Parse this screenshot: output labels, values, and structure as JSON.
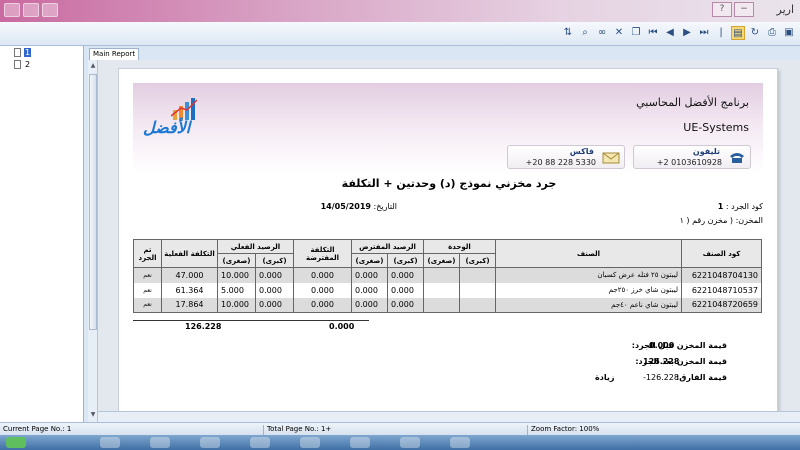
{
  "window": {
    "title": "ارير"
  },
  "tree": {
    "items": [
      "1",
      "2"
    ]
  },
  "tab": {
    "label": "Main Report"
  },
  "report": {
    "company_ar": "برنامج الأفضل المحاسبي",
    "company_en": "UE-Systems",
    "logo_text": "الأفضل",
    "fax_label": "فاكس",
    "fax_value": "+20 88 228 5330",
    "phone_label": "تليفون",
    "phone_value": "+2 0103610928",
    "title": "جرد مخزني نموذج (د) وحدتين + التكلفة",
    "inventory_code_label": "كود الجرد :",
    "inventory_code": "1",
    "date_label": "التاريخ:",
    "date": "14/05/2019",
    "store_label": "المخزن: ( مخزن رقم ( ١",
    "headers": {
      "item_code": "كود الصنف",
      "item": "الصنف",
      "unit": "الوحدة",
      "unit_big": "(كبرى)",
      "unit_small": "(صغرى)",
      "assumed_balance": "الرصيد المفترض",
      "assumed_cost": "التكلفة المفترضة",
      "actual_balance": "الرصيد الفعلي",
      "actual_cost": "التكلفة الفعلية",
      "counted": "تم الجرد"
    },
    "rows": [
      {
        "code": "6221048704130",
        "item": "ليبتون ٢٥ فتله عرض كسبان",
        "unit_big": "",
        "unit_small": "",
        "assumed_big": "0.000",
        "assumed_small": "0.000",
        "assumed_cost": "0.000",
        "actual_big": "0.000",
        "actual_small": "10.000",
        "actual_cost": "47.000",
        "counted": "نعم"
      },
      {
        "code": "6221048710537",
        "item": "ليبتون شاي خرز ٢٥٠جم",
        "unit_big": "",
        "unit_small": "",
        "assumed_big": "0.000",
        "assumed_small": "0.000",
        "assumed_cost": "0.000",
        "actual_big": "0.000",
        "actual_small": "5.000",
        "actual_cost": "61.364",
        "counted": "نعم"
      },
      {
        "code": "6221048720659",
        "item": "ليبتون شاي ناعم ٤٠جم",
        "unit_big": "",
        "unit_small": "",
        "assumed_big": "0.000",
        "assumed_small": "0.000",
        "assumed_cost": "0.000",
        "actual_big": "0.000",
        "actual_small": "10.000",
        "actual_cost": "17.864",
        "counted": "نعم"
      }
    ],
    "total_actual_cost": "126.228",
    "total_assumed_cost": "0.000",
    "summary": {
      "before_label": "قيمة المخزن قبل الجرد:",
      "before_value": "0.000",
      "after_label": "قيمة المخزن بعد الجرد:",
      "after_value": "126.228",
      "diff_label": "قيمة الفارق:",
      "diff_value": "-126.228",
      "diff_note": "زيادة"
    }
  },
  "status": {
    "current_page": "Current Page No.: 1",
    "total_page": "Total Page No.: 1+",
    "zoom": "Zoom Factor: 100%"
  }
}
